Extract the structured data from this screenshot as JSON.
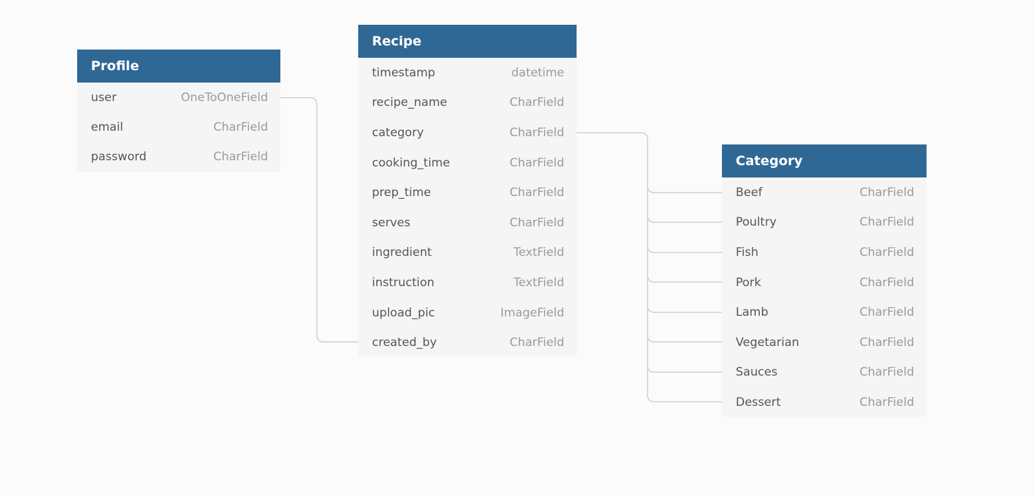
{
  "tables": {
    "profile": {
      "title": "Profile",
      "fields": [
        {
          "name": "user",
          "type": "OneToOneField"
        },
        {
          "name": "email",
          "type": "CharField"
        },
        {
          "name": "password",
          "type": "CharField"
        }
      ]
    },
    "recipe": {
      "title": "Recipe",
      "fields": [
        {
          "name": "timestamp",
          "type": "datetime"
        },
        {
          "name": "recipe_name",
          "type": "CharField"
        },
        {
          "name": "category",
          "type": "CharField"
        },
        {
          "name": "cooking_time",
          "type": "CharField"
        },
        {
          "name": "prep_time",
          "type": "CharField"
        },
        {
          "name": "serves",
          "type": "CharField"
        },
        {
          "name": "ingredient",
          "type": "TextField"
        },
        {
          "name": "instruction",
          "type": "TextField"
        },
        {
          "name": "upload_pic",
          "type": "ImageField"
        },
        {
          "name": "created_by",
          "type": "CharField"
        }
      ]
    },
    "category": {
      "title": "Category",
      "fields": [
        {
          "name": "Beef",
          "type": "CharField"
        },
        {
          "name": "Poultry",
          "type": "CharField"
        },
        {
          "name": "Fish",
          "type": "CharField"
        },
        {
          "name": "Pork",
          "type": "CharField"
        },
        {
          "name": "Lamb",
          "type": "CharField"
        },
        {
          "name": "Vegetarian",
          "type": "CharField"
        },
        {
          "name": "Sauces",
          "type": "CharField"
        },
        {
          "name": "Dessert",
          "type": "CharField"
        }
      ]
    }
  },
  "colors": {
    "header_bg": "#306895",
    "header_text": "#ffffff",
    "table_bg": "#f5f5f5",
    "field_name": "#555555",
    "field_type": "#9a9a9a",
    "connector": "#cfcfcf",
    "canvas_bg": "#fbfbfb"
  }
}
